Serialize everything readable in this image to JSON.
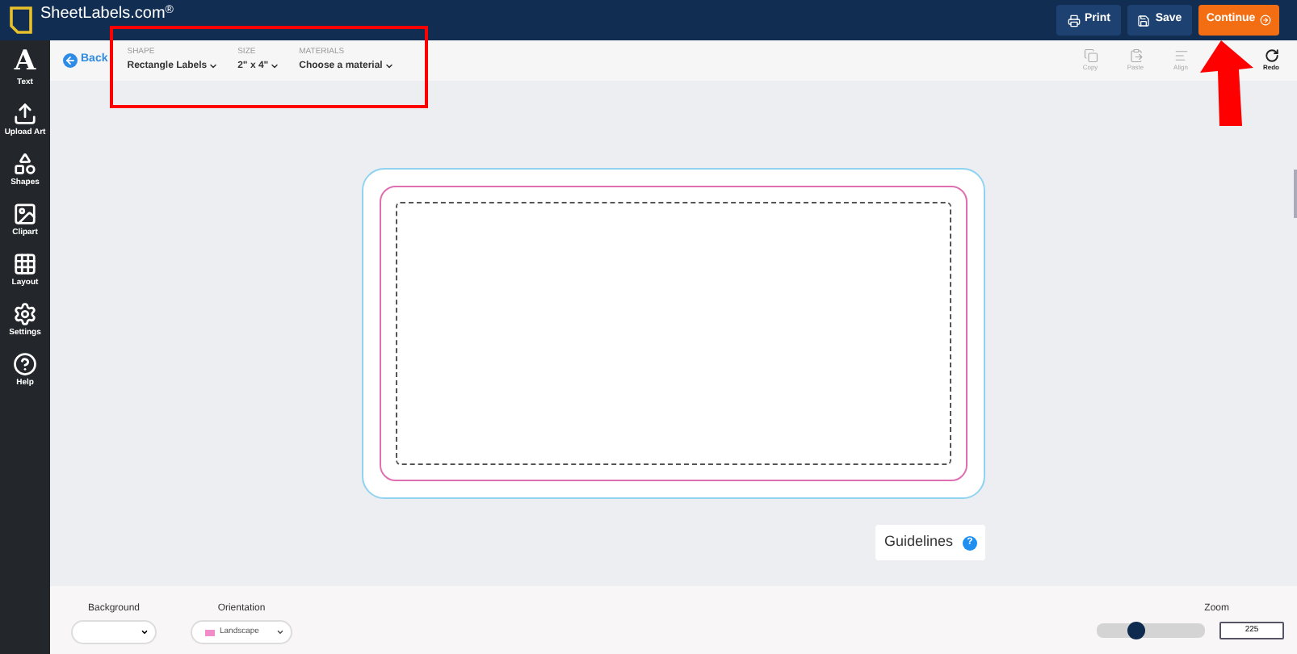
{
  "header": {
    "logo": "SheetLabels.com",
    "logo_mark": "®",
    "buttons": [
      {
        "label": "Print",
        "kind": "print"
      },
      {
        "label": "Save",
        "kind": "save"
      },
      {
        "label": "Continue",
        "kind": "continue"
      }
    ]
  },
  "sidebar": {
    "items": [
      {
        "label": "Text",
        "kind": "text",
        "glyph": "A"
      },
      {
        "label": "Upload Art",
        "kind": "upload"
      },
      {
        "label": "Shapes",
        "kind": "shapes"
      },
      {
        "label": "Clipart",
        "kind": "clipart"
      },
      {
        "label": "Layout",
        "kind": "layout"
      },
      {
        "label": "Settings",
        "kind": "settings"
      },
      {
        "label": "Help",
        "kind": "help"
      }
    ]
  },
  "toolbar": {
    "back": "Back",
    "selectors": [
      {
        "heading": "SHAPE",
        "value": "Rectangle Labels"
      },
      {
        "heading": "SIZE",
        "value": "2\" x 4\""
      },
      {
        "heading": "MATERIALS",
        "value": "Choose a material"
      }
    ],
    "actions": [
      {
        "label": "Copy",
        "kind": "copy",
        "disabled": true
      },
      {
        "label": "Paste",
        "kind": "paste",
        "disabled": true
      },
      {
        "label": "Align",
        "kind": "align",
        "disabled": true
      },
      {
        "label": "Redo",
        "kind": "redo",
        "disabled": false
      }
    ]
  },
  "guidelines": {
    "label": "Guidelines",
    "help": "?"
  },
  "bottom": {
    "background": {
      "label": "Background"
    },
    "orientation": {
      "label": "Orientation",
      "value": "Landscape"
    },
    "zoom": {
      "label": "Zoom",
      "level": 0.36,
      "value": "225"
    }
  }
}
